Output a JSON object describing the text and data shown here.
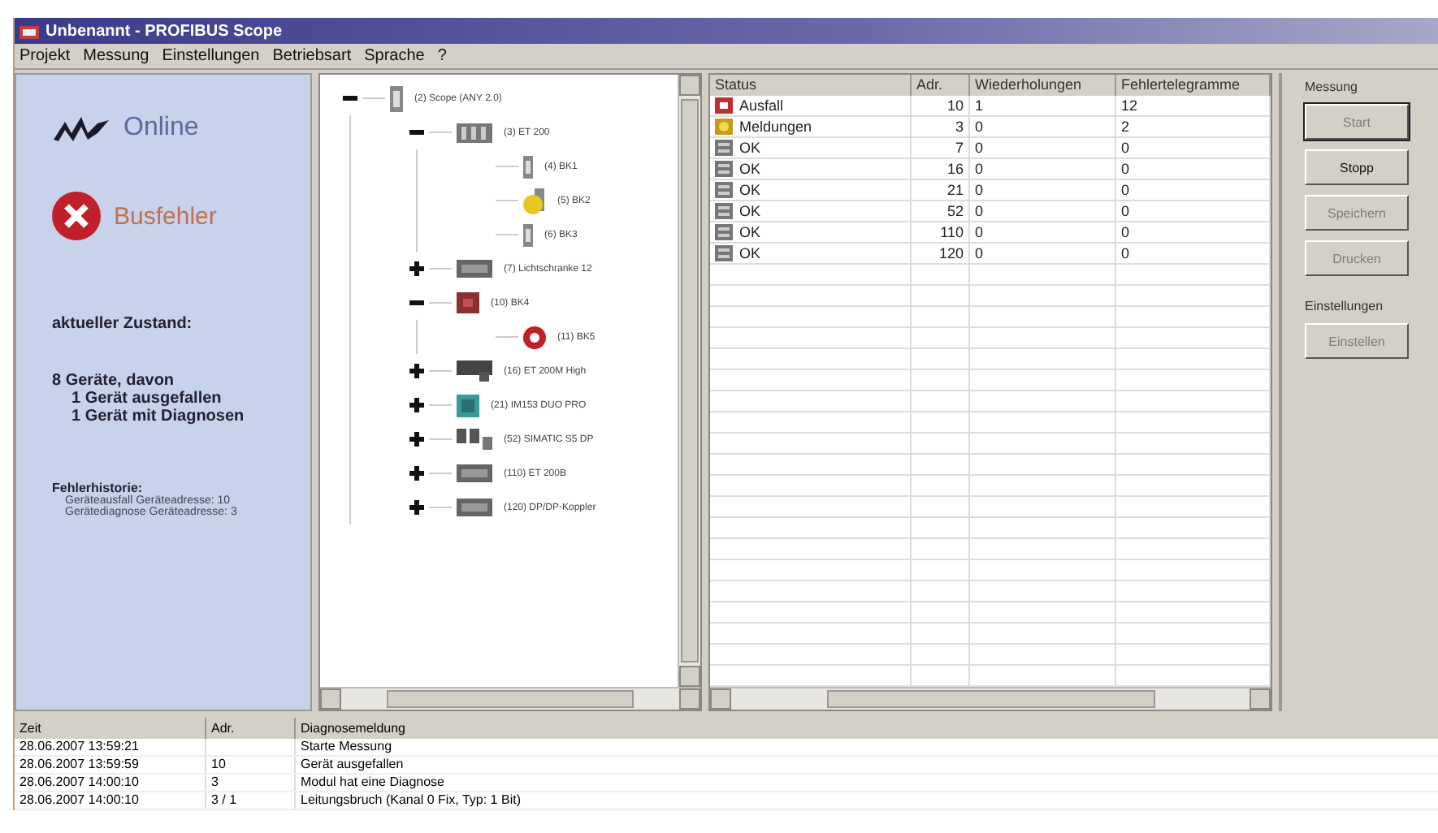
{
  "window": {
    "title": "Unbenannt - PROFIBUS Scope"
  },
  "menu": [
    "Projekt",
    "Messung",
    "Einstellungen",
    "Betriebsart",
    "Sprache",
    "?"
  ],
  "status_panel": {
    "online": "Online",
    "bus_error": "Busfehler",
    "state_heading": "aktueller Zustand:",
    "summary": "8 Geräte, davon",
    "details": [
      "1 Gerät ausgefallen",
      "1 Gerät mit Diagnosen"
    ],
    "history_heading": "Fehlerhistorie:",
    "history": [
      "Geräteausfall Geräteadresse: 10",
      "Gerätediagnose Geräteadresse: 3"
    ]
  },
  "tree": [
    {
      "label": "(2) Scope (ANY 2.0)",
      "kind": "rack",
      "expanded": true,
      "children": [
        {
          "label": "(3) ET 200",
          "kind": "module",
          "expanded": true,
          "children": [
            {
              "label": "(4) BK1",
              "kind": "slot"
            },
            {
              "label": "(5) BK2",
              "kind": "warning"
            },
            {
              "label": "(6) BK3",
              "kind": "slot"
            }
          ]
        },
        {
          "label": "(7) Lichtschranke 12",
          "kind": "device",
          "expanded": false
        },
        {
          "label": "(10) BK4",
          "kind": "red-device",
          "expanded": true,
          "children": [
            {
              "label": "(11) BK5",
              "kind": "error"
            }
          ]
        },
        {
          "label": "(16) ET 200M High",
          "kind": "drive",
          "expanded": false
        },
        {
          "label": "(21) IM153 DUO PRO",
          "kind": "teal-device",
          "expanded": false
        },
        {
          "label": "(52) SIMATIC S5 DP",
          "kind": "network",
          "expanded": false
        },
        {
          "label": "(110) ET 200B",
          "kind": "device",
          "expanded": false
        },
        {
          "label": "(120) DP/DP-Koppler",
          "kind": "device",
          "expanded": false
        }
      ]
    }
  ],
  "table": {
    "columns": [
      "Status",
      "Adr.",
      "Wiederholungen",
      "Fehlertelegramme"
    ],
    "rows": [
      {
        "kind": "error",
        "status": "Ausfall",
        "address": "10",
        "repeats": "1",
        "errors": "12"
      },
      {
        "kind": "warning",
        "status": "Meldungen",
        "address": "3",
        "repeats": "0",
        "errors": "2"
      },
      {
        "kind": "ok",
        "status": "OK",
        "address": "7",
        "repeats": "0",
        "errors": "0"
      },
      {
        "kind": "ok",
        "status": "OK",
        "address": "16",
        "repeats": "0",
        "errors": "0"
      },
      {
        "kind": "ok",
        "status": "OK",
        "address": "21",
        "repeats": "0",
        "errors": "0"
      },
      {
        "kind": "ok",
        "status": "OK",
        "address": "52",
        "repeats": "0",
        "errors": "0"
      },
      {
        "kind": "ok",
        "status": "OK",
        "address": "110",
        "repeats": "0",
        "errors": "0"
      },
      {
        "kind": "ok",
        "status": "OK",
        "address": "120",
        "repeats": "0",
        "errors": "0"
      }
    ]
  },
  "side_panel": [
    {
      "heading": "Messung",
      "buttons": [
        {
          "label": "Start",
          "disabled": true,
          "default": true
        },
        {
          "label": "Stopp",
          "disabled": false,
          "default": false
        },
        {
          "label": "Speichern",
          "disabled": true,
          "default": false
        },
        {
          "label": "Drucken",
          "disabled": true,
          "default": false
        }
      ]
    },
    {
      "heading": "Einstellungen",
      "buttons": [
        {
          "label": "Einstellen",
          "disabled": true,
          "default": false
        }
      ]
    }
  ],
  "log": {
    "columns": [
      "Zeit",
      "Adr.",
      "Diagnosemeldung"
    ],
    "rows": [
      {
        "time": "28.06.2007 13:59:21",
        "address": "",
        "message": "Starte Messung"
      },
      {
        "time": "28.06.2007 13:59:59",
        "address": "10",
        "message": "Gerät ausgefallen"
      },
      {
        "time": "28.06.2007 14:00:10",
        "address": "3",
        "message": "Modul hat eine Diagnose"
      },
      {
        "time": "28.06.2007 14:00:10",
        "address": "3 / 1",
        "message": "Leitungsbruch (Kanal 0 Fix, Typ: 1 Bit)"
      }
    ]
  }
}
